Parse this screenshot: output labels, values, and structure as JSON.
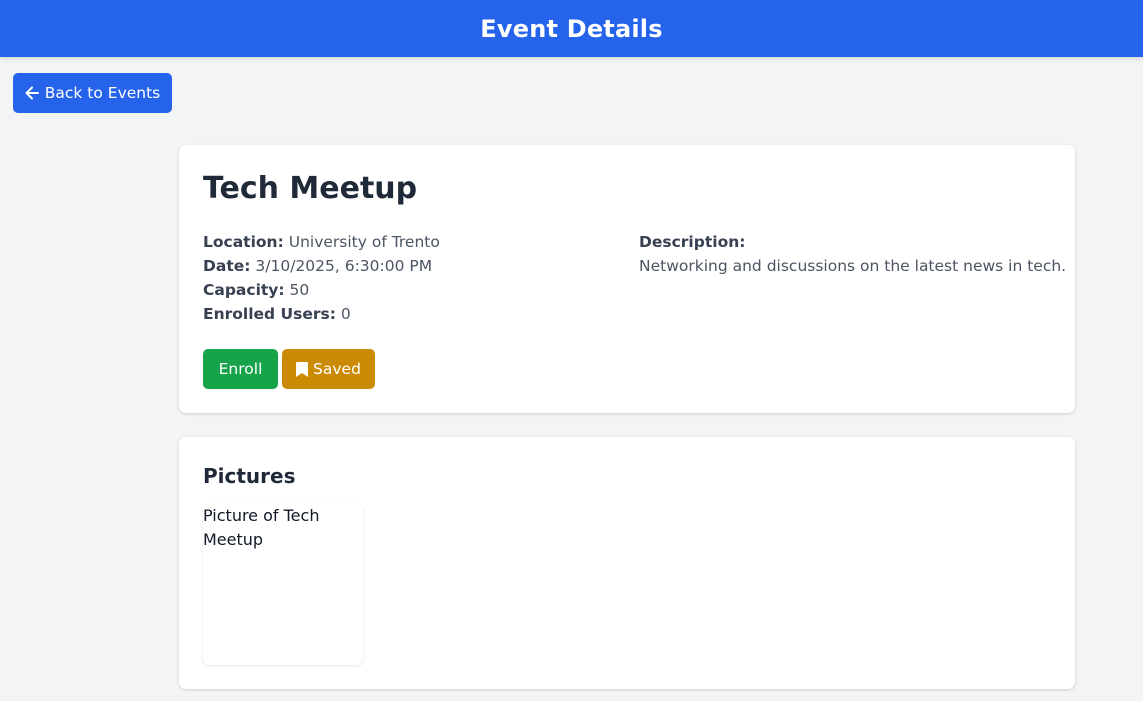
{
  "header": {
    "title": "Event Details"
  },
  "nav": {
    "back_label": "Back to Events",
    "back_icon": "arrow-left-icon"
  },
  "event": {
    "title": "Tech Meetup",
    "location_label": "Location:",
    "location": "University of Trento",
    "date_label": "Date:",
    "date": "3/10/2025, 6:30:00 PM",
    "capacity_label": "Capacity:",
    "capacity": "50",
    "enrolled_label": "Enrolled Users:",
    "enrolled": "0",
    "description_label": "Description:",
    "description": "Networking and discussions on the latest news in tech."
  },
  "actions": {
    "enroll_label": "Enroll",
    "saved_label": "Saved",
    "saved_icon": "bookmark-icon"
  },
  "pictures": {
    "heading": "Pictures",
    "items": [
      {
        "alt": "Picture of Tech Meetup"
      }
    ]
  },
  "colors": {
    "primary": "#2563eb",
    "success": "#16a34a",
    "warning": "#ca8a04",
    "background": "#f3f4f6"
  }
}
